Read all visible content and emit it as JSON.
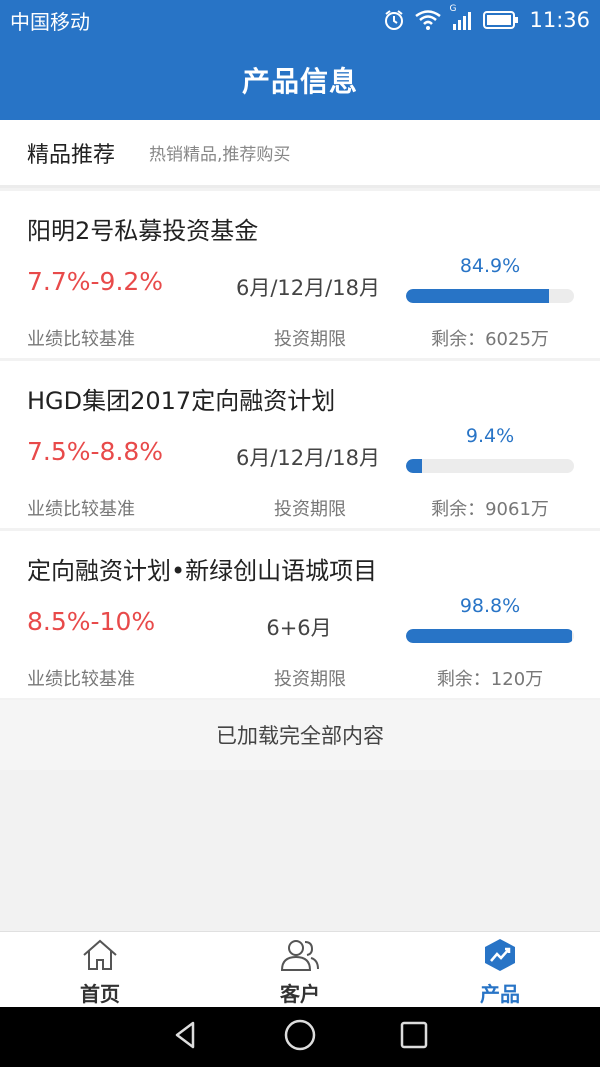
{
  "status": {
    "carrier": "中国移动",
    "time": "11:36",
    "network": "G"
  },
  "header": {
    "title": "产品信息"
  },
  "section": {
    "title": "精品推荐",
    "subtitle": "热销精品,推荐购买"
  },
  "products": [
    {
      "name": "阳明2号私募投资基金",
      "rate": "7.7%-9.2%",
      "term": "6月/12月/18月",
      "progress_text": "84.9%",
      "progress": 0.849,
      "rate_label": "业绩比较基准",
      "term_label": "投资期限",
      "remaining": "剩余：6025万"
    },
    {
      "name": "HGD集团2017定向融资计划",
      "rate": "7.5%-8.8%",
      "term": "6月/12月/18月",
      "progress_text": "9.4%",
      "progress": 0.094,
      "rate_label": "业绩比较基准",
      "term_label": "投资期限",
      "remaining": "剩余：9061万"
    },
    {
      "name": "定向融资计划•新绿创山语城项目",
      "rate": "8.5%-10%",
      "term": "6+6月",
      "progress_text": "98.8%",
      "progress": 0.988,
      "rate_label": "业绩比较基准",
      "term_label": "投资期限",
      "remaining": "剩余：120万"
    }
  ],
  "footer_message": "已加载完全部内容",
  "tabs": [
    {
      "label": "首页",
      "icon": "home-icon",
      "active": false
    },
    {
      "label": "客户",
      "icon": "customers-icon",
      "active": false
    },
    {
      "label": "产品",
      "icon": "product-chart-icon",
      "active": true
    }
  ],
  "colors": {
    "primary": "#2874c6",
    "rate_red": "#e84a4a"
  }
}
